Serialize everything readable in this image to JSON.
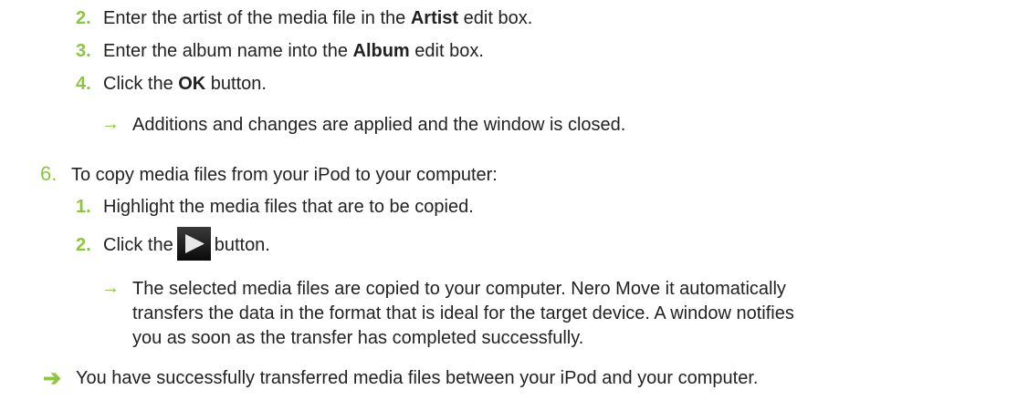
{
  "accent_color": "#8cc63f",
  "substeps_a": [
    {
      "num": "2.",
      "pre": "Enter the artist of the media file in the ",
      "bold": "Artist",
      "post": " edit box."
    },
    {
      "num": "3.",
      "pre": "Enter the album name into the ",
      "bold": "Album",
      "post": " edit box."
    },
    {
      "num": "4.",
      "pre": "Click the ",
      "bold": "OK",
      "post": " button."
    }
  ],
  "result_a": "Additions and changes are applied and the window is closed.",
  "step6": {
    "num": "6.",
    "text": "To copy media files from your iPod to your computer:"
  },
  "substeps_b": [
    {
      "num": "1.",
      "text": "Highlight the media files that are to be copied."
    },
    {
      "num": "2.",
      "pre": "Click the",
      "post": "button.",
      "icon": "play-icon"
    }
  ],
  "result_b": [
    "The selected media files are copied to your computer. Nero Move it automatically",
    "transfers the data in the format that is ideal for the target device. A window notifies",
    "you as soon as the transfer has completed successfully."
  ],
  "final_result": "You have successfully transferred media files between your iPod and your computer.",
  "icons": {
    "arrow": "arrow-right-icon",
    "result": "result-arrow-icon"
  }
}
